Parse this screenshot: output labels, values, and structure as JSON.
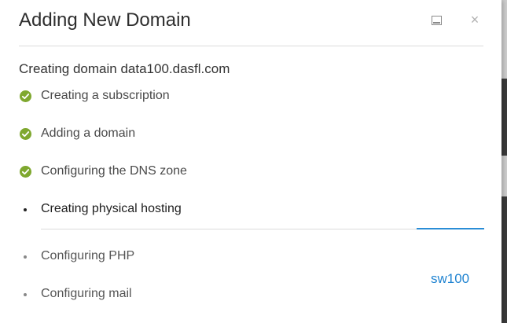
{
  "dialog": {
    "title": "Adding New Domain",
    "subtitle": "Creating domain data100.dasfl.com",
    "close_glyph": "×"
  },
  "icons": {
    "minimize": "minimize-icon",
    "close": "close-icon",
    "done": "check-circle-icon",
    "bullet": "bullet-icon"
  },
  "steps": [
    {
      "label": "Creating a subscription",
      "status": "done"
    },
    {
      "label": "Adding a domain",
      "status": "done"
    },
    {
      "label": "Configuring the DNS zone",
      "status": "done"
    },
    {
      "label": "Creating physical hosting",
      "status": "active"
    },
    {
      "label": "Configuring PHP",
      "status": "pending"
    },
    {
      "label": "Configuring mail",
      "status": "pending"
    }
  ],
  "progress": {
    "active_step_fraction": 0.15
  },
  "server_link": "sw100",
  "colors": {
    "accent": "#2a8dd6",
    "success": "#7fa82f",
    "link": "#1f83d1"
  }
}
